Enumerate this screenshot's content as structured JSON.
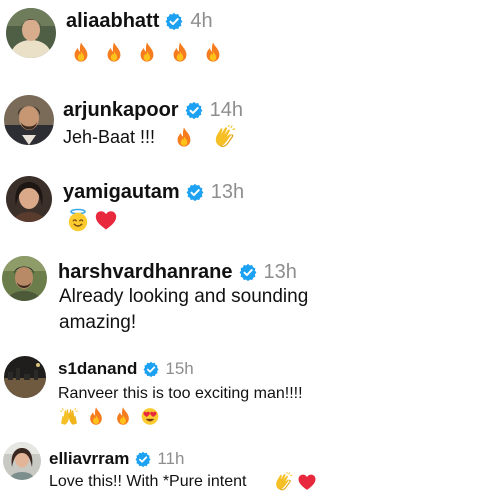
{
  "colors": {
    "verified_badge": "#1da1f2",
    "time_text": "#8e8e8e",
    "text": "#111111"
  },
  "comments": [
    {
      "username": "aliaabhatt",
      "verified": true,
      "time": "4h",
      "text": "",
      "emojis": [
        "fire-icon",
        "fire-icon",
        "fire-icon",
        "fire-icon",
        "fire-icon"
      ]
    },
    {
      "username": "arjunkapoor",
      "verified": true,
      "time": "14h",
      "text": "Jeh-Baat !!!",
      "emojis": [
        "fire-icon",
        "clapping-hands-icon"
      ]
    },
    {
      "username": "yamigautam",
      "verified": true,
      "time": "13h",
      "text": "",
      "emojis": [
        "angel-face-icon",
        "red-heart-icon"
      ]
    },
    {
      "username": "harshvardhanrane",
      "verified": true,
      "time": "13h",
      "text_lines": [
        "Already looking and sounding",
        "amazing!"
      ],
      "emojis": []
    },
    {
      "username": "s1danand",
      "verified": true,
      "time": "15h",
      "text": "Ranveer this is too exciting man!!!!",
      "emojis": [
        "raising-hands-icon",
        "fire-icon",
        "fire-icon",
        "heart-eyes-icon"
      ]
    },
    {
      "username": "elliavrram",
      "verified": true,
      "time": "11h",
      "text": "Love this!! With *Pure intent",
      "emojis": [
        "clapping-hands-icon",
        "red-heart-icon"
      ]
    }
  ]
}
